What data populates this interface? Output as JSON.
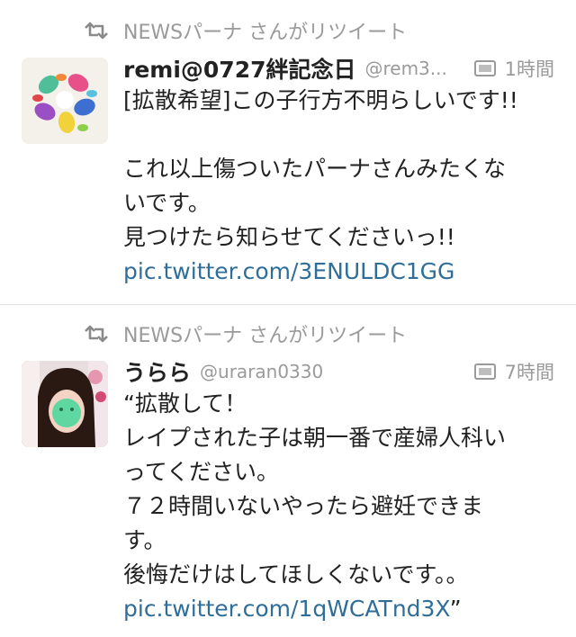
{
  "tweets": [
    {
      "retweet_label": "NEWSパーナ さんがリツイート",
      "name": "remi@0727絆記念日",
      "handle": "@rem3...",
      "time": "1時間",
      "lines": [
        "[拡散希望]この子行方不明らしいです!!",
        "",
        "これ以上傷ついたパーナさんみたくな",
        "いです。",
        "見つけたら知らせてくださいっ!!"
      ],
      "link": "pic.twitter.com/3ENULDC1GG"
    },
    {
      "retweet_label": "NEWSパーナ さんがリツイート",
      "name": "うらら",
      "handle": "@uraran0330",
      "time": "7時間",
      "lines": [
        "“拡散して！",
        "レイプされた子は朝一番で産婦人科い",
        "ってください。",
        "７２時間いないやったら避妊できま",
        "す。",
        "後悔だけはしてほしくないです。。"
      ],
      "link": "pic.twitter.com/1qWCATnd3X",
      "link_suffix": "”"
    }
  ],
  "icons": {
    "retweet": "retweet-icon",
    "media": "media-icon"
  },
  "colors": {
    "secondary_text": "#9a9a9a",
    "link": "#2f6e99",
    "divider": "#e1e1e1"
  }
}
